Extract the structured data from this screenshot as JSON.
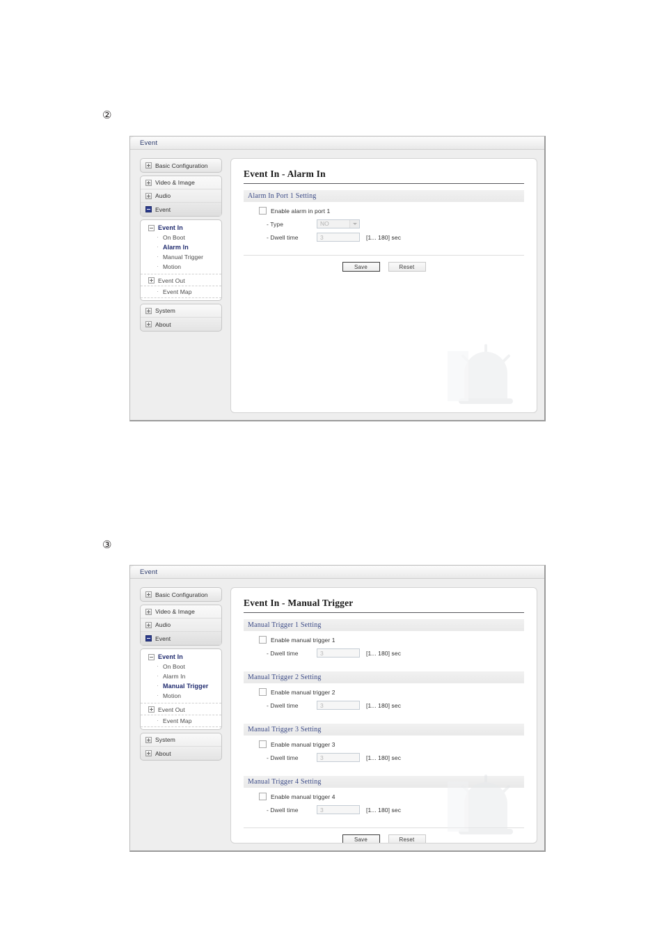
{
  "steps": [
    {
      "id": "step-2",
      "label": "②"
    },
    {
      "id": "step-3",
      "label": "③"
    }
  ],
  "window": {
    "title": "Event"
  },
  "sidebar": {
    "top_items": [
      {
        "label": "Basic Configuration",
        "icon": "expand-box-icon"
      }
    ],
    "group_items": [
      {
        "label": "Video & Image",
        "icon": "expand-box-icon"
      },
      {
        "label": "Audio",
        "icon": "expand-box-icon"
      },
      {
        "label": "Event",
        "icon": "collapse-box-icon-selected"
      }
    ],
    "tree": {
      "root": {
        "label": "Event In",
        "toggle": "minus-box-icon"
      },
      "children": [
        {
          "label": "On Boot"
        },
        {
          "label": "Alarm In"
        },
        {
          "label": "Manual Trigger"
        },
        {
          "label": "Motion"
        }
      ],
      "event_out": {
        "label": "Event Out",
        "toggle": "plus-box-icon"
      },
      "event_map": {
        "label": "Event Map"
      }
    },
    "bottom_items": [
      {
        "label": "System",
        "icon": "expand-box-icon"
      },
      {
        "label": "About",
        "icon": "expand-box-icon"
      }
    ]
  },
  "panel_alarm_in": {
    "heading": "Event In - Alarm In",
    "section_title": "Alarm In Port 1 Setting",
    "enable_label": "Enable alarm in port 1",
    "type_label": "- Type",
    "type_value": "NO",
    "dwell_label": "- Dwell time",
    "dwell_value": "3",
    "dwell_hint": "[1... 180] sec",
    "save_label": "Save",
    "reset_label": "Reset"
  },
  "panel_manual_trigger": {
    "heading": "Event In - Manual Trigger",
    "dwell_label": "- Dwell time",
    "dwell_value": "3",
    "dwell_hint": "[1... 180] sec",
    "save_label": "Save",
    "reset_label": "Reset",
    "sections": [
      {
        "section_title": "Manual Trigger 1 Setting",
        "enable_label": "Enable manual trigger 1"
      },
      {
        "section_title": "Manual Trigger 2 Setting",
        "enable_label": "Enable manual trigger 2"
      },
      {
        "section_title": "Manual Trigger 3 Setting",
        "enable_label": "Enable manual trigger 3"
      },
      {
        "section_title": "Manual Trigger 4 Setting",
        "enable_label": "Enable manual trigger 4"
      }
    ]
  },
  "colors": {
    "title_text": "#2b3a6b",
    "section_text": "#3b4a86",
    "selected_menu": "#2b3a8c"
  }
}
